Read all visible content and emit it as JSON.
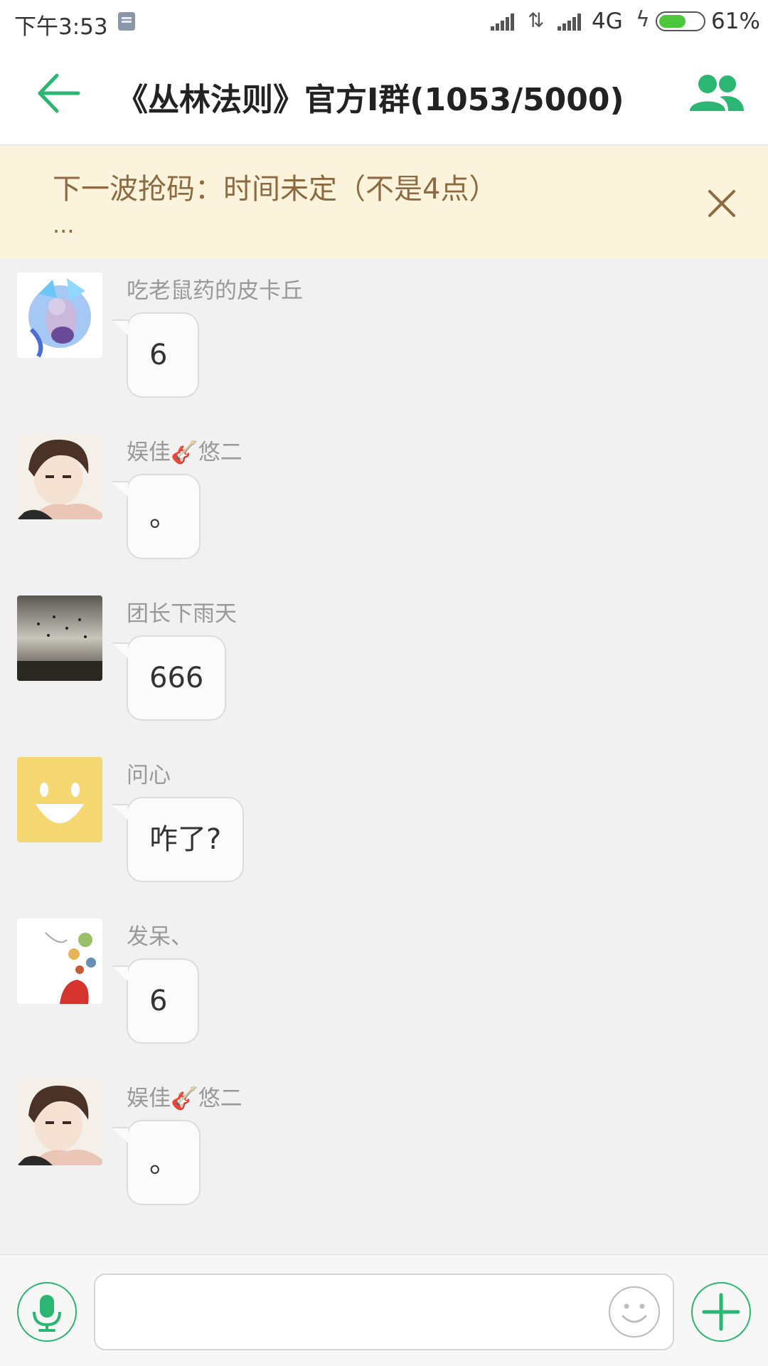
{
  "status_bar": {
    "time": "下午3:53",
    "network": "4G",
    "battery_percent_label": "61%",
    "battery_level": 0.61,
    "app_icon": "notes-icon"
  },
  "header": {
    "title": "《丛林法则》官方I群(1053/5000)",
    "back_icon": "arrow-left-icon",
    "members_icon": "group-members-icon",
    "accent_color": "#2bb673"
  },
  "notice": {
    "text": "下一波抢码：时间未定（不是4点）",
    "more": "...",
    "close_icon": "close-icon",
    "background": "#fcf3dc",
    "text_color": "#8d6a42"
  },
  "messages": [
    {
      "sender": "吃老鼠药的皮卡丘",
      "text": "6",
      "avatar": "mewtwo-avatar"
    },
    {
      "sender": "娱佳🎸悠二",
      "text": "。",
      "avatar": "anime-boy-avatar"
    },
    {
      "sender": "团长下雨天",
      "text": "666",
      "avatar": "stormy-sky-avatar"
    },
    {
      "sender": "问心",
      "text": "咋了?",
      "avatar": "smiley-avatar"
    },
    {
      "sender": "发呆、",
      "text": "6",
      "avatar": "painting-avatar"
    },
    {
      "sender": "娱佳🎸悠二",
      "text": "。",
      "avatar": "anime-boy-avatar"
    }
  ],
  "input_bar": {
    "voice_icon": "microphone-icon",
    "input_value": "",
    "emoji_icon": "smiley-face-icon",
    "plus_icon": "plus-icon"
  }
}
